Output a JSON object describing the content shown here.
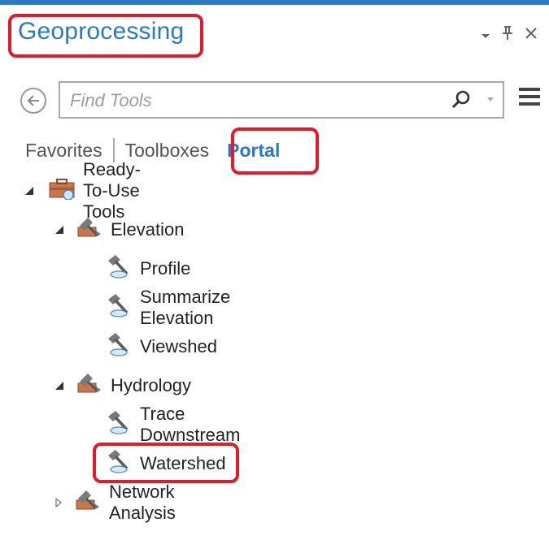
{
  "window": {
    "title": "Geoprocessing"
  },
  "search": {
    "placeholder": "Find Tools"
  },
  "tabs": [
    {
      "label": "Favorites"
    },
    {
      "label": "Toolboxes"
    },
    {
      "label": "Portal",
      "active": true
    }
  ],
  "tree": {
    "root": {
      "label": "Ready-To-Use Tools",
      "expanded": true
    },
    "elevation": {
      "label": "Elevation",
      "expanded": true
    },
    "elevation_tools": [
      {
        "label": "Profile"
      },
      {
        "label": "Summarize Elevation"
      },
      {
        "label": "Viewshed"
      }
    ],
    "hydrology": {
      "label": "Hydrology",
      "expanded": true
    },
    "hydrology_tools": [
      {
        "label": "Trace Downstream"
      },
      {
        "label": "Watershed"
      }
    ],
    "network": {
      "label": "Network Analysis",
      "expanded": false
    }
  },
  "colors": {
    "accent": "#2a7ac3",
    "highlight": "#e6192b"
  }
}
